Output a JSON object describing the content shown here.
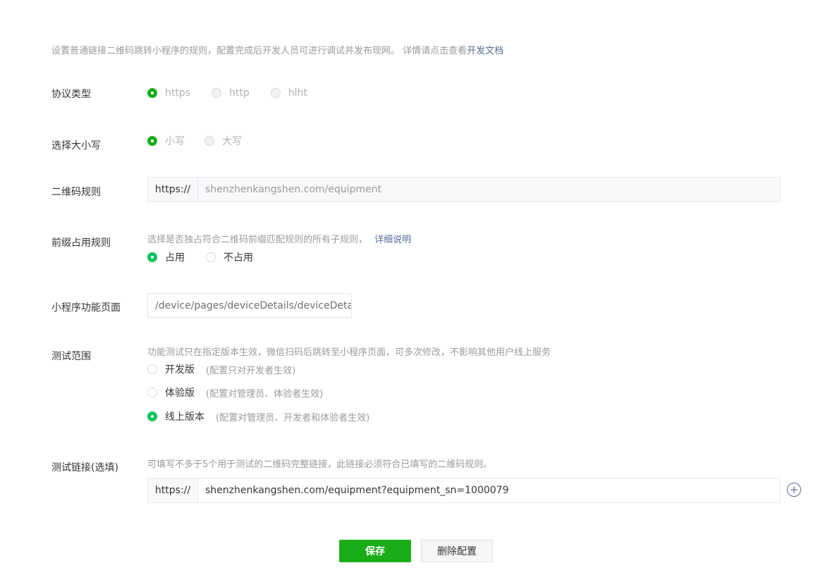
{
  "intro": {
    "text": "设置普通链接二维码跳转小程序的规则，配置完成后开发人员可进行调试并发布现网。 详情请点击查看",
    "link": "开发文档"
  },
  "protocol": {
    "label": "协议类型",
    "options": [
      "https",
      "http",
      "hlht"
    ],
    "selected": "https"
  },
  "case": {
    "label": "选择大小写",
    "options": [
      "小写",
      "大写"
    ],
    "selected": "小写"
  },
  "qr_rule": {
    "label": "二维码规则",
    "prefix": "https://",
    "value": "shenzhenkangshen.com/equipment"
  },
  "prefix_rule": {
    "label": "前缀占用规则",
    "hint": "选择是否独占符合二维码前缀匹配规则的所有子规则，",
    "link": "详细说明",
    "options": [
      "占用",
      "不占用"
    ],
    "selected": "占用"
  },
  "page_path": {
    "label": "小程序功能页面",
    "value": "/device/pages/deviceDetails/deviceDeta"
  },
  "test_scope": {
    "label": "测试范围",
    "hint": "功能测试只在指定版本生效，微信扫码后跳转至小程序页面，可多次修改，不影响其他用户线上服务",
    "options": [
      {
        "name": "开发版",
        "note": "(配置只对开发者生效)"
      },
      {
        "name": "体验版",
        "note": "(配置对管理员、体验者生效)"
      },
      {
        "name": "线上版本",
        "note": "(配置对管理员、开发者和体验者生效)"
      }
    ],
    "selected": "线上版本"
  },
  "test_link": {
    "label": "测试链接(选填)",
    "hint": "可填写不多于5个用于测试的二维码完整链接，此链接必须符合已填写的二维码规则。",
    "prefix": "https://",
    "value": "shenzhenkangshen.com/equipment?equipment_sn=1000079",
    "add_icon": "plus-circle-icon"
  },
  "actions": {
    "save": "保存",
    "delete": "删除配置"
  },
  "colors": {
    "primary": "#1aad19",
    "radio_active": "#07c160",
    "link": "#576b95"
  }
}
